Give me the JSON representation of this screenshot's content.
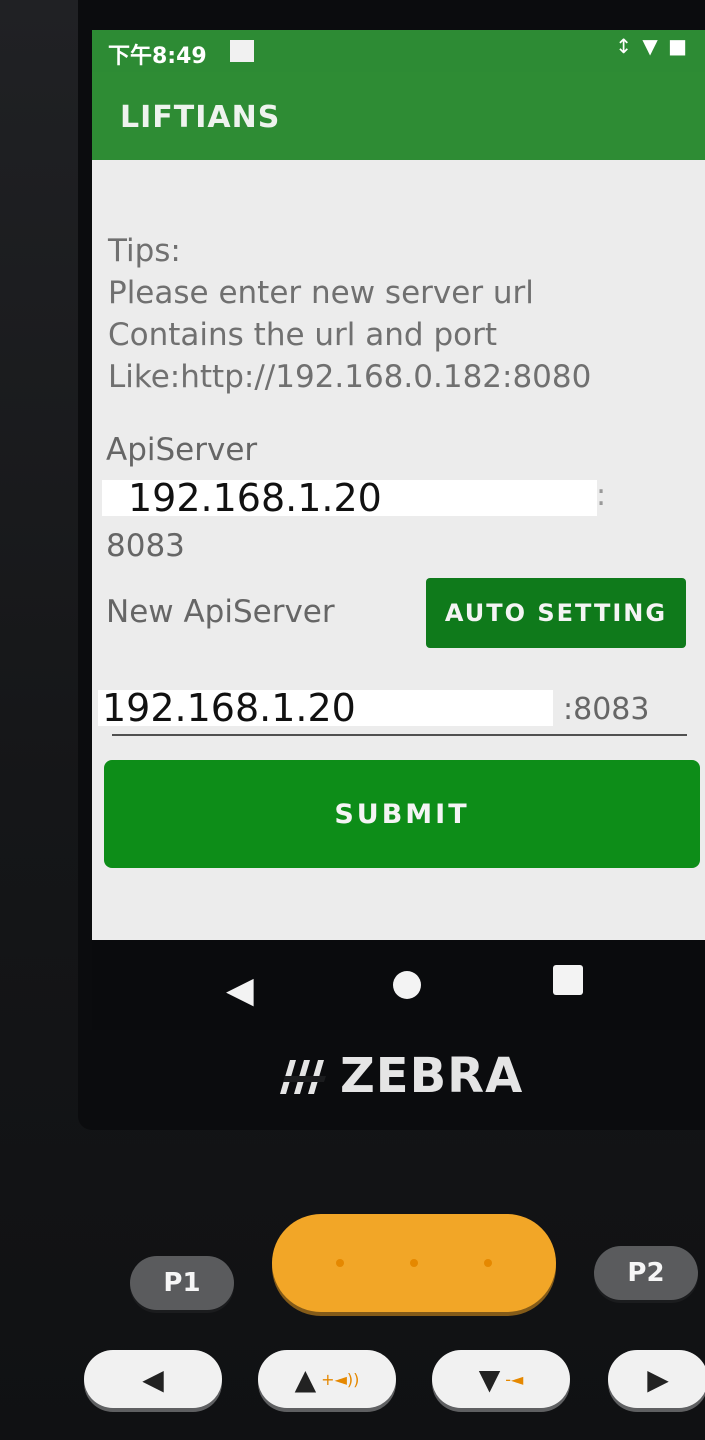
{
  "status_bar": {
    "time": "下午8:49",
    "icons": "↕ ▼ ■"
  },
  "app": {
    "title": "LIFTIANS",
    "tips": [
      "Tips:",
      "Please enter new server url",
      "Contains the url and port",
      "Like:http://192.168.0.182:8080"
    ],
    "api_label": "ApiServer",
    "api_value": "192.168.1.20",
    "api_colon": ":",
    "api_port": "8083",
    "new_api_label": "New ApiServer",
    "auto_setting_label": "AUTO SETTING",
    "new_api_input_value": "192.168.1.20",
    "new_api_port": ":8083",
    "submit_label": "SUBMIT"
  },
  "navigation": {
    "back": "◀"
  },
  "device": {
    "brand": "ZEBRA",
    "p1_label": "P1",
    "p2_label": "P2",
    "arrow_left": "◀",
    "arrow_up": "▲",
    "arrow_down": "▼",
    "arrow_right": "▶",
    "volume_up_mark": "+◄))",
    "volume_down_mark": "-◄"
  },
  "colors": {
    "app_bar": "#2e8c34",
    "button_green": "#0d8d18",
    "scan_button": "#f2a627"
  }
}
